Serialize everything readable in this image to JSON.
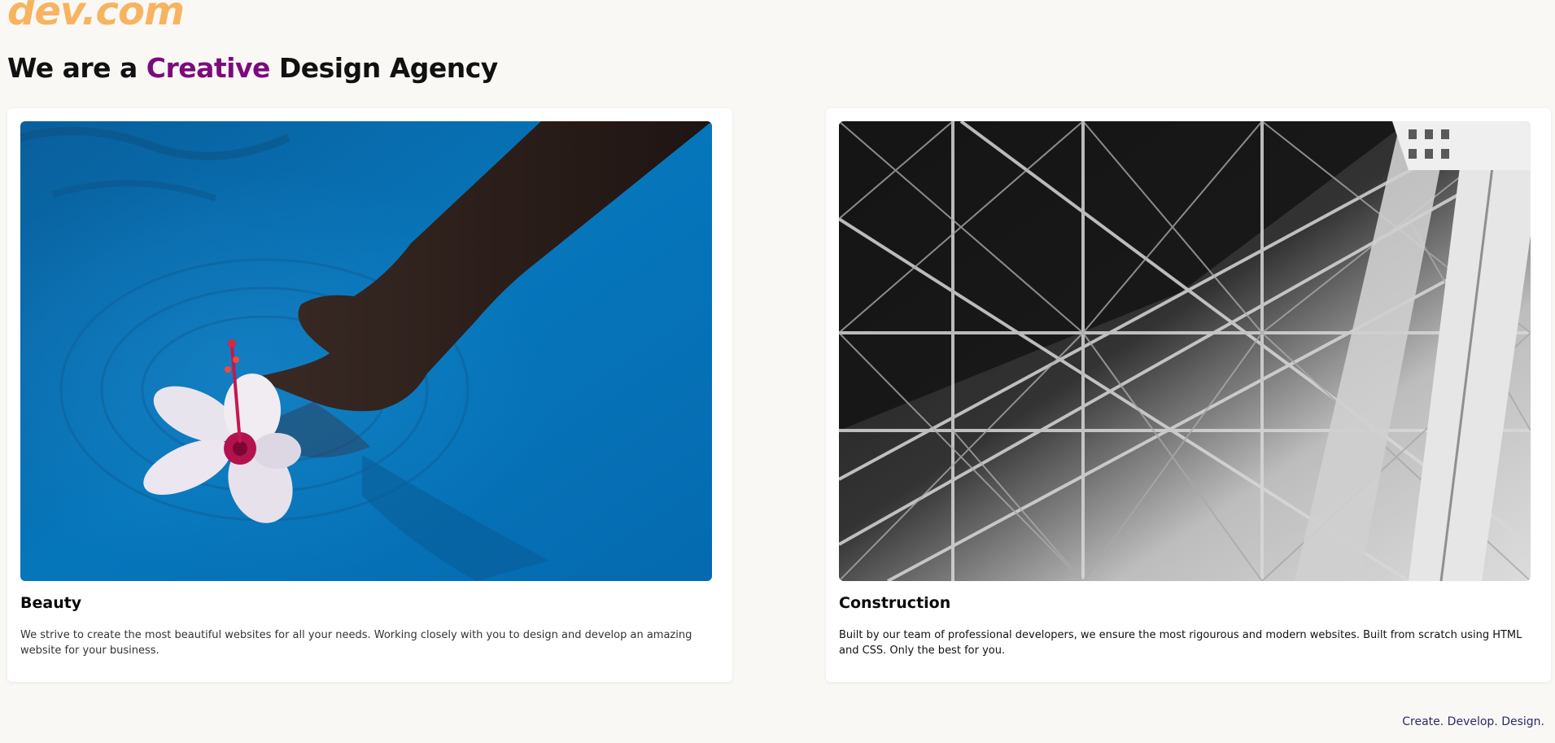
{
  "brand": {
    "logo_text": "dev.com",
    "color": "#f7b460"
  },
  "hero": {
    "headline_prefix": "We are a ",
    "headline_accent": "Creative",
    "headline_suffix": " Design Agency",
    "accent_color": "#7d0a7d"
  },
  "cards": [
    {
      "title": "Beauty",
      "description": "We strive to create the most beautiful websites for all your needs. Working closely with you to design and develop an amazing website for your business.",
      "image": "hand-and-hibiscus-flower-in-blue-water"
    },
    {
      "title": "Construction",
      "description": "Built by our team of professional developers, we ensure the most rigourous and modern websites. Built from scratch using HTML and CSS. Only the best for you.",
      "image": "black-and-white-steel-lattice-structure"
    }
  ],
  "footer": {
    "tagline": "Create. Develop. Design."
  }
}
